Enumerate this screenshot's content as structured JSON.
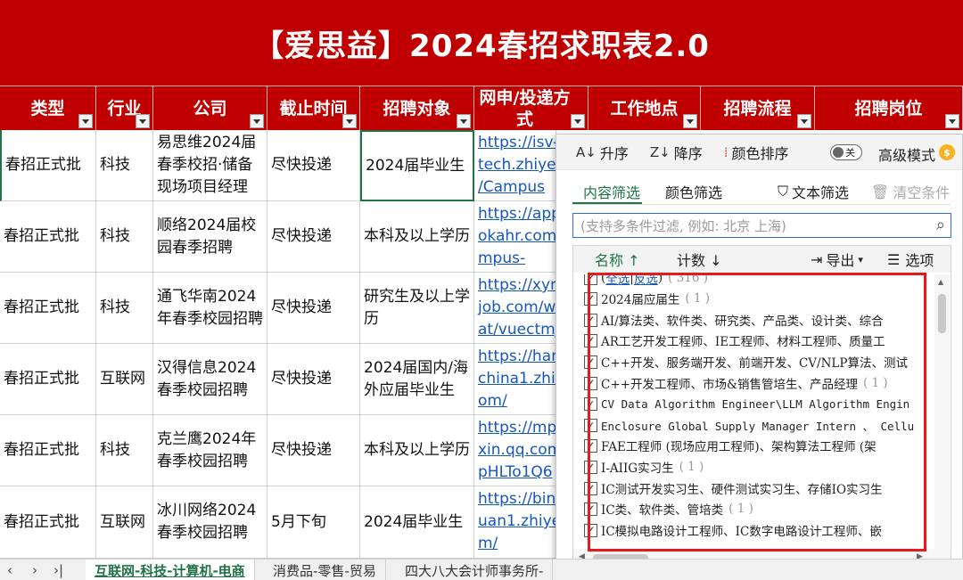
{
  "title": "【爱思益】2024春招求职表2.0",
  "columns": [
    {
      "label": "类型"
    },
    {
      "label": "行业"
    },
    {
      "label": "公司"
    },
    {
      "label": "截止时间"
    },
    {
      "label": "招聘对象"
    },
    {
      "label": "网申/投递方式"
    },
    {
      "label": "工作地点"
    },
    {
      "label": "招聘流程"
    },
    {
      "label": "招聘岗位"
    }
  ],
  "rows": [
    {
      "type": "春招正式批",
      "industry": "科技",
      "company": "易思维2024届春季校招·储备现场项目经理",
      "deadline": "尽快投递",
      "target": "2024届毕业生",
      "link": [
        "https://isv-",
        "tech.zhiye.",
        "/Campus"
      ]
    },
    {
      "type": "春招正式批",
      "industry": "科技",
      "company": "顺络2024届校园春季招聘",
      "deadline": "尽快投递",
      "target": "本科及以上学历",
      "link": [
        "https://app",
        "okahr.com",
        "mpus-"
      ]
    },
    {
      "type": "春招正式批",
      "industry": "科技",
      "company": "通飞华南2024年春季校园招聘",
      "deadline": "尽快投递",
      "target": "研究生及以上学历",
      "link": [
        "https://xyn",
        "job.com/w",
        "at/vuectmj"
      ]
    },
    {
      "type": "春招正式批",
      "industry": "互联网",
      "company": "汉得信息2024春季校园招聘",
      "deadline": "尽快投递",
      "target": "2024届国内/海外应届毕业生",
      "link": [
        "https://har",
        "china1.zhiy",
        "om/"
      ]
    },
    {
      "type": "春招正式批",
      "industry": "科技",
      "company": "克兰鹰2024年春季校园招聘",
      "deadline": "尽快投递",
      "target": "本科及以上学历",
      "link": [
        "https://mp",
        "xin.qq.com",
        "pHLTo1Q6"
      ]
    },
    {
      "type": "春招正式批",
      "industry": "互联网",
      "company": "冰川网络2024春季校园招聘",
      "deadline": "5月下旬",
      "target": "2024届毕业生",
      "link": [
        "https://bin",
        "uan1.zhiye",
        "m/"
      ]
    }
  ],
  "filter_panel": {
    "sort_asc": "升序",
    "sort_desc": "降序",
    "sort_color": "颜色排序",
    "toggle_state": "关",
    "advanced_mode": "高级模式",
    "tab_content": "内容筛选",
    "tab_color": "颜色筛选",
    "text_filter": "文本筛选",
    "clear_conditions": "清空条件",
    "search_placeholder": "(支持多条件过滤, 例如: 北京 上海)",
    "col_name": "名称",
    "col_count": "计数",
    "export": "导出",
    "options": "选项",
    "select_all": "全选",
    "invert": "反选",
    "total": "316",
    "items": [
      {
        "label": "2024届应届生",
        "count": "1"
      },
      {
        "label": "AI/算法类、软件类、研究类、产品类、设计类、综合",
        "count": ""
      },
      {
        "label": "AR工艺开发工程师、IE工程师、材料工程师、质量工",
        "count": ""
      },
      {
        "label": "C++开发、服务端开发、前端开发、CV/NLP算法、测试",
        "count": ""
      },
      {
        "label": "C++开发工程师、市场&销售管培生、产品经理",
        "count": "1"
      },
      {
        "label": "CV Data Algorithm Engineer\\LLM Algorithm Engin",
        "count": ""
      },
      {
        "label": "Enclosure Global Supply Manager Intern 、 Cellu",
        "count": ""
      },
      {
        "label": "FAE工程师 (现场应用工程师)、架构算法工程师 (架",
        "count": ""
      },
      {
        "label": "I-AIIG实习生",
        "count": "1"
      },
      {
        "label": "IC测试开发实习生、硬件测试实习生、存储IO实习生",
        "count": ""
      },
      {
        "label": "IC类、软件类、管培类",
        "count": "1"
      },
      {
        "label": "IC模拟电路设计工程师、IC数字电路设计工程师、嵌",
        "count": ""
      }
    ]
  },
  "sheet_tabs": [
    "互联网-科技-计算机-电商",
    "消费品-零售-贸易",
    "四大八大会计师事务所-"
  ],
  "colors": {
    "header_red": "#c00000",
    "accent_green": "#217346",
    "highlight_red": "#e8191a",
    "link_blue": "#1557c0"
  }
}
